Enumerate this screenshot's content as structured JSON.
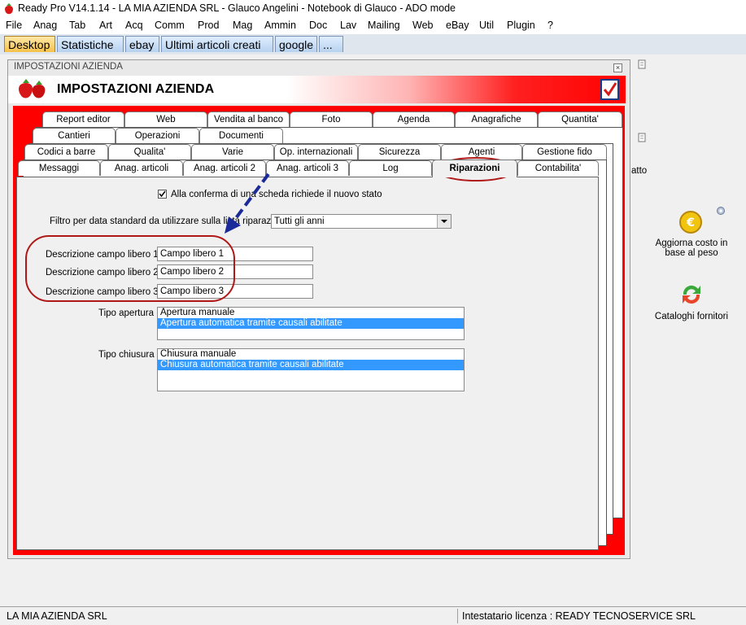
{
  "app": {
    "title": "Ready Pro V14.1.14 - LA MIA AZIENDA SRL - Glauco Angelini - Notebook di Glauco - ADO mode"
  },
  "menu": [
    "File",
    "Anag",
    "Tab",
    "Art",
    "Acq",
    "Comm",
    "Prod",
    "Mag",
    "Ammin",
    "Doc",
    "Lav",
    "Mailing",
    "Web",
    "eBay",
    "Util",
    "Plugin",
    "?"
  ],
  "desktop_tabs": [
    "Desktop",
    "Statistiche",
    "ebay",
    "Ultimi articoli creati",
    "google",
    "..."
  ],
  "window": {
    "title": "IMPOSTAZIONI AZIENDA",
    "header_title": "IMPOSTAZIONI AZIENDA"
  },
  "tabs": {
    "row1": [
      "Report editor",
      "Web",
      "Vendita al banco",
      "Foto",
      "Agenda",
      "Anagrafiche",
      "Quantita'"
    ],
    "row2": [
      "Cantieri",
      "Operazioni",
      "Documenti"
    ],
    "row3": [
      "Codici a barre",
      "Qualita'",
      "Varie",
      "Op. internazionali",
      "Sicurezza",
      "Agenti",
      "Gestione fido"
    ],
    "row4": [
      "Messaggi",
      "Anag. articoli",
      "Anag. articoli 2",
      "Anag. articoli 3",
      "Log",
      "Riparazioni",
      "Contabilita'"
    ]
  },
  "form": {
    "checkbox_label": "Alla conferma di una scheda richiede il nuovo stato",
    "checkbox_checked": true,
    "filter_label": "Filtro per data standard da utilizzare sulla lista riparazioni :",
    "filter_value": "Tutti gli anni",
    "field1_label": "Descrizione campo libero 1 :",
    "field1_value": "Campo libero 1",
    "field2_label": "Descrizione campo libero 2 :",
    "field2_value": "Campo libero 2",
    "field3_label": "Descrizione campo libero 3 :",
    "field3_value": "Campo libero 3",
    "apertura_label": "Tipo apertura :",
    "apertura_options": [
      "Apertura manuale",
      "Apertura automatica tramite causali abilitate"
    ],
    "chiusura_label": "Tipo chiusura :",
    "chiusura_options": [
      "Chiusura manuale",
      "Chiusura automatica tramite causali abilitate"
    ]
  },
  "side": {
    "partial_label": "atto",
    "item1": "Aggiorna costo in base al peso",
    "item2": "Cataloghi fornitori"
  },
  "status": {
    "left": "LA MIA AZIENDA SRL",
    "right": "Intestatario licenza : READY TECNOSERVICE SRL"
  },
  "colors": {
    "accent_red": "#ff0000",
    "selection_blue": "#3399ff",
    "annotation_blue": "#1a2a9a",
    "annotation_red": "#b01818"
  }
}
